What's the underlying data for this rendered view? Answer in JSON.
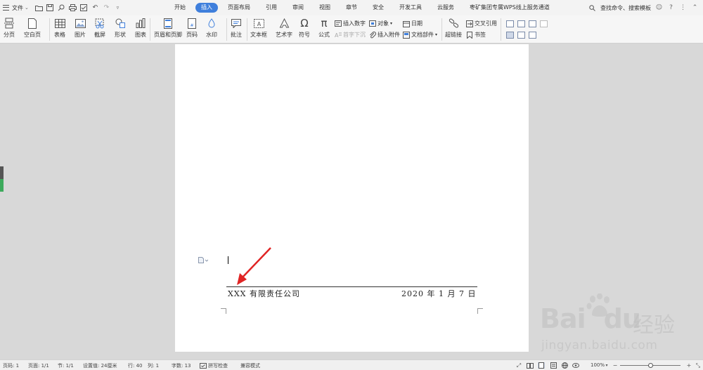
{
  "menubar": {
    "file_label": "文件",
    "tabs": [
      {
        "label": "开始"
      },
      {
        "label": "插入",
        "active": true
      },
      {
        "label": "页面布局"
      },
      {
        "label": "引用"
      },
      {
        "label": "审阅"
      },
      {
        "label": "视图"
      },
      {
        "label": "章节"
      },
      {
        "label": "安全"
      },
      {
        "label": "开发工具"
      },
      {
        "label": "云服务"
      },
      {
        "label": "枣矿集团专属WPS线上服务通道"
      }
    ],
    "search_label": "查找命令、搜索模板"
  },
  "ribbon": {
    "page_break": "分页",
    "blank_page": "空白页",
    "table": "表格",
    "picture": "图片",
    "screenshot": "截屏",
    "shape": "形状",
    "chart": "图表",
    "header_footer": "页眉和页脚",
    "page_number": "页码",
    "watermark": "水印",
    "comment": "批注",
    "text_box": "文本框",
    "word_art": "艺术字",
    "symbol": "符号",
    "formula": "公式",
    "insert_number": "插入数字",
    "drop_cap": "首字下沉",
    "object": "对象",
    "attachment": "插入附件",
    "date": "日期",
    "doc_parts": "文档部件",
    "hyperlink": "超链接",
    "cross_ref": "交叉引用",
    "bookmark": "书签"
  },
  "document": {
    "footer_left": "XXX 有限责任公司",
    "footer_right": "2020 年 1 月 7 日"
  },
  "statusbar": {
    "page_num": "页码: 1",
    "pages": "页面: 1/1",
    "section": "节: 1/1",
    "setting": "设置值: 24厘米",
    "row": "行: 40",
    "col": "列: 1",
    "word_count": "字数: 13",
    "spell_check": "拼写检查",
    "compat_mode": "兼容模式",
    "zoom": "100%"
  },
  "watermark": {
    "brand": "Bai",
    "brand2": "du",
    "cn": "经验",
    "url": "jingyan.baidu.com"
  },
  "colors": {
    "accent": "#3f7fdc",
    "arrow": "#e02424",
    "side_green": "#3daa5c"
  }
}
